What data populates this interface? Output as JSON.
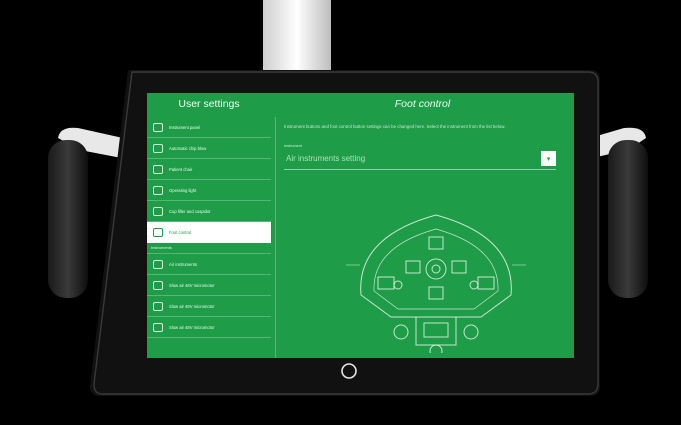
{
  "window": {
    "left_title": "User settings",
    "right_title": "Foot control"
  },
  "sidebar": {
    "items": [
      {
        "label": "Instrument panel",
        "icon": "instrument-panel-icon"
      },
      {
        "label": "Automatic chip blow",
        "icon": "air-blow-icon"
      },
      {
        "label": "Patient chair",
        "icon": "patient-chair-icon"
      },
      {
        "label": "Operating light",
        "icon": "light-icon"
      },
      {
        "label": "Cup filler and cuspidor",
        "icon": "cup-icon"
      },
      {
        "label": "Foot control",
        "icon": "foot-control-icon",
        "active": true
      }
    ],
    "section_label": "Instruments",
    "instrument_items": [
      {
        "label": "Air instruments",
        "icon": "instrument-icon"
      },
      {
        "label": "Slow air 48V micromotor",
        "icon": "instrument-icon"
      },
      {
        "label": "Slow air 48V micromotor",
        "icon": "instrument-icon"
      },
      {
        "label": "Slow air 48V micromotor",
        "icon": "instrument-icon"
      }
    ]
  },
  "main": {
    "description": "Instrument buttons and foot control button settings can be changed here. Select the instrument from the list below.",
    "select_label": "Instrument",
    "select_value": "Air instruments setting",
    "select_button_icon": "chevron-down-icon"
  },
  "colors": {
    "screen_green": "#1f9c48",
    "accent_white": "#ffffff"
  }
}
